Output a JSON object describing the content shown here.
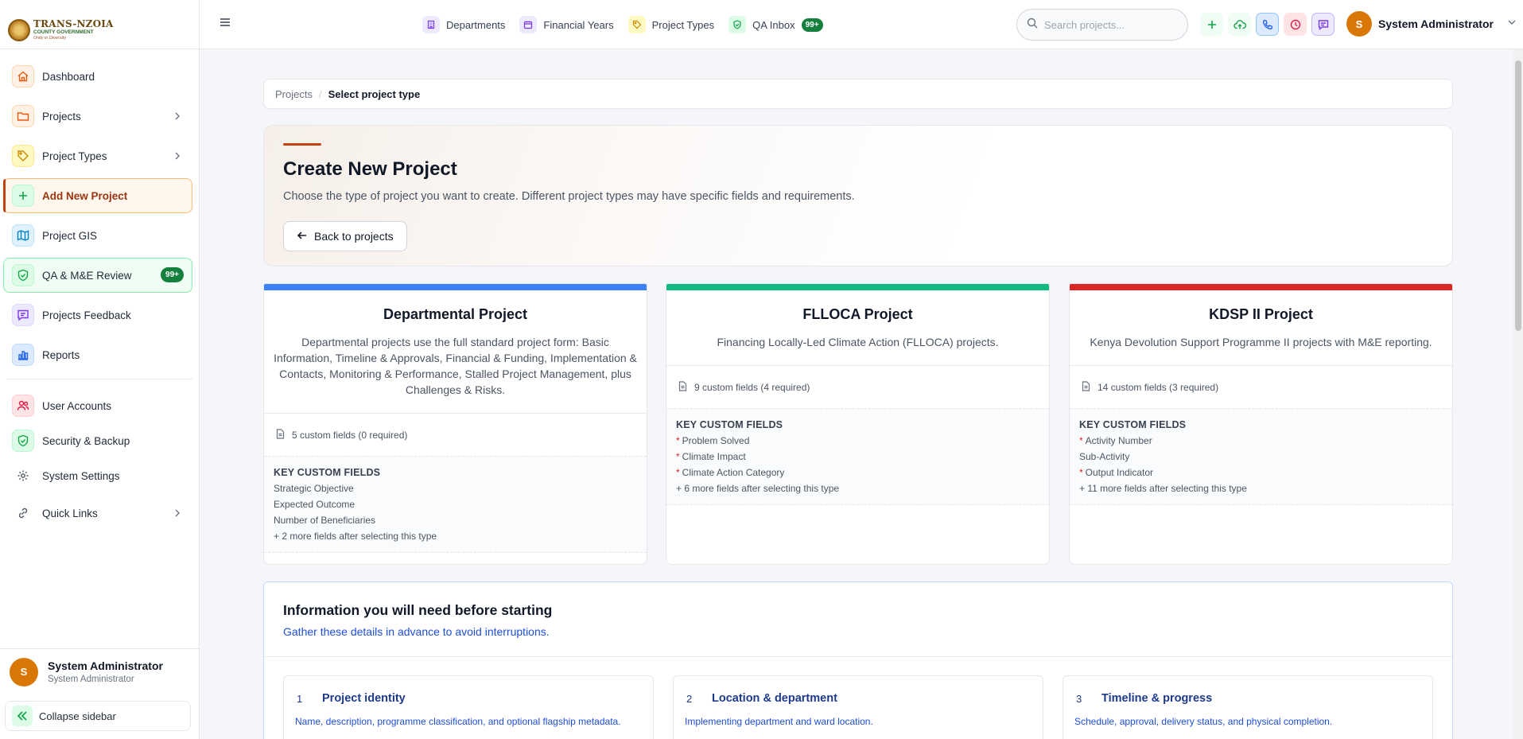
{
  "logo": {
    "line1": "TRANS-NZOIA",
    "line2": "COUNTY GOVERNMENT",
    "line3": "Unity in Diversity"
  },
  "sidebar": {
    "items": [
      {
        "label": "Dashboard"
      },
      {
        "label": "Projects"
      },
      {
        "label": "Project Types"
      },
      {
        "label": "Add New Project"
      },
      {
        "label": "Project GIS"
      },
      {
        "label": "QA & M&E Review",
        "badge": "99+"
      },
      {
        "label": "Projects Feedback"
      },
      {
        "label": "Reports"
      },
      {
        "label": "User Accounts"
      },
      {
        "label": "Security & Backup"
      },
      {
        "label": "System Settings"
      },
      {
        "label": "Quick Links"
      }
    ],
    "user": {
      "initial": "S",
      "name": "System Administrator",
      "role": "System Administrator"
    },
    "collapse_label": "Collapse sidebar"
  },
  "topbar": {
    "links": [
      {
        "label": "Departments"
      },
      {
        "label": "Financial Years"
      },
      {
        "label": "Project Types"
      },
      {
        "label": "QA Inbox",
        "badge": "99+"
      }
    ],
    "search_placeholder": "Search projects...",
    "user": {
      "initial": "S",
      "name": "System Administrator"
    }
  },
  "breadcrumb": {
    "parent": "Projects",
    "current": "Select project type"
  },
  "hero": {
    "title": "Create New Project",
    "subtitle": "Choose the type of project you want to create. Different project types may have specific fields and requirements.",
    "back_label": "Back to projects"
  },
  "cards": [
    {
      "title": "Departmental Project",
      "description": "Departmental projects use the full standard project form: Basic Information, Timeline & Approvals, Financial & Funding, Implementation & Contacts, Monitoring & Performance, Stalled Project Management, plus Challenges & Risks.",
      "meta": "5 custom fields (0 required)",
      "key_title": "KEY CUSTOM FIELDS",
      "fields": [
        "Strategic Objective",
        "Expected Outcome",
        "Number of Beneficiaries"
      ],
      "more": "+ 2 more fields after selecting this type",
      "accent": "#3b82f6"
    },
    {
      "title": "FLLOCA Project",
      "description": "Financing Locally-Led Climate Action (FLLOCA) projects.",
      "meta": "9 custom fields (4 required)",
      "key_title": "KEY CUSTOM FIELDS",
      "fields": [
        "Problem Solved",
        "Climate Impact",
        "Climate Action Category"
      ],
      "more": "+ 6 more fields after selecting this type",
      "accent": "#10b981"
    },
    {
      "title": "KDSP II Project",
      "description": "Kenya Devolution Support Programme II projects with M&E reporting.",
      "meta": "14 custom fields (3 required)",
      "key_title": "KEY CUSTOM FIELDS",
      "fields": [
        "Activity Number",
        "Sub-Activity",
        "Output Indicator"
      ],
      "more": "+ 11 more fields after selecting this type",
      "accent": "#dc2626"
    }
  ],
  "info": {
    "title": "Information you will need before starting",
    "subtitle": "Gather these details in advance to avoid interruptions.",
    "steps": [
      {
        "num": "1",
        "title": "Project identity",
        "desc": "Name, description, programme classification, and optional flagship metadata."
      },
      {
        "num": "2",
        "title": "Location & department",
        "desc": "Implementing department and ward location."
      },
      {
        "num": "3",
        "title": "Timeline & progress",
        "desc": "Schedule, approval, delivery status, and physical completion."
      }
    ]
  }
}
